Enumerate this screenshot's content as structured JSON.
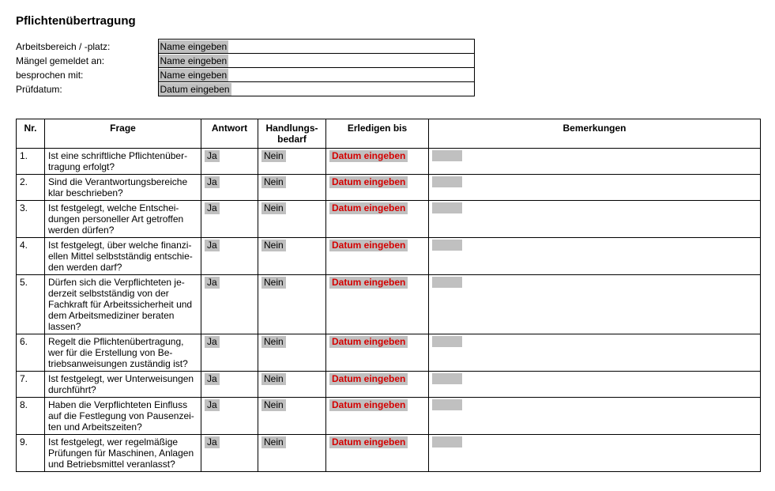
{
  "title": "Pflichtenübertragung",
  "meta": {
    "rows": [
      {
        "label": "Arbeitsbereich / -platz:",
        "placeholder": "Name eingeben"
      },
      {
        "label": "Mängel gemeldet an:",
        "placeholder": "Name eingeben"
      },
      {
        "label": "besprochen mit:",
        "placeholder": "Name eingeben"
      },
      {
        "label": "Prüfdatum:",
        "placeholder": "Datum eingeben"
      }
    ]
  },
  "table": {
    "headers": {
      "nr": "Nr.",
      "frage": "Frage",
      "antwort": "Antwort",
      "handlung_l1": "Handlungs-",
      "handlung_l2": "bedarf",
      "erledigen": "Erledigen bis",
      "bemerkungen": "Bemerkungen"
    },
    "answer_yes": "Ja",
    "answer_no": "Nein",
    "date_placeholder": "Datum eingeben",
    "remark_placeholder": " ",
    "rows": [
      {
        "nr": "1.",
        "frage": "Ist eine schriftliche Pflichtenüber­tragung erfolgt?"
      },
      {
        "nr": "2.",
        "frage": "Sind die Verantwortungsbereiche klar beschrieben?"
      },
      {
        "nr": "3.",
        "frage": "Ist festgelegt, welche Entschei­dungen personeller Art getroffen werden dürfen?"
      },
      {
        "nr": "4.",
        "frage": "Ist festgelegt, über welche finanzi­ellen Mittel selbstständig entschie­den werden darf?"
      },
      {
        "nr": "5.",
        "frage": "Dürfen sich die Verpflichteten je­derzeit selbstständig von der Fachkraft für Arbeitssicherheit und dem Arbeitsmediziner beraten lassen?"
      },
      {
        "nr": "6.",
        "frage": "Regelt die Pflichtenübertragung, wer für die Erstellung von Be­triebsanweisungen zuständig ist?"
      },
      {
        "nr": "7.",
        "frage": "Ist festgelegt, wer Unterweisungen durchführt?"
      },
      {
        "nr": "8.",
        "frage": "Haben die Verpflichteten Einfluss auf die Festlegung von Pausenzei­ten und Arbeitszeiten?"
      },
      {
        "nr": "9.",
        "frage": "Ist festgelegt, wer regelmäßige Prüfungen für Maschinen, Anlagen und Betriebsmittel veranlasst?"
      }
    ]
  }
}
